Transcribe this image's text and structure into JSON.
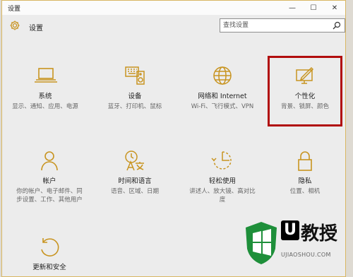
{
  "window": {
    "title": "设置",
    "controls": {
      "minimize": "—",
      "maximize": "☐",
      "close": "✕"
    }
  },
  "header": {
    "app_title": "设置",
    "search_placeholder": "查找设置"
  },
  "tiles": [
    {
      "icon": "laptop-icon",
      "label": "系统",
      "desc": "显示、通知、应用、电源"
    },
    {
      "icon": "keyboard-speaker-icon",
      "label": "设备",
      "desc": "蓝牙、打印机、鼠标"
    },
    {
      "icon": "globe-icon",
      "label": "网络和 Internet",
      "desc": "Wi-Fi、飞行模式、VPN"
    },
    {
      "icon": "paint-monitor-icon",
      "label": "个性化",
      "desc": "背景、锁屏、颜色"
    },
    {
      "icon": "person-icon",
      "label": "帐户",
      "desc": "你的帐户、电子邮件、同步设置、工作、其他用户"
    },
    {
      "icon": "language-icon",
      "label": "时间和语言",
      "desc": "语音、区域、日期"
    },
    {
      "icon": "ease-of-access-icon",
      "label": "轻松使用",
      "desc": "讲述人、放大镜、高对比度"
    },
    {
      "icon": "lock-icon",
      "label": "隐私",
      "desc": "位置、相机"
    },
    {
      "icon": "update-icon",
      "label": "更新和安全",
      "desc": ""
    }
  ],
  "watermark": {
    "brand": "教授",
    "letter": "U",
    "site": "UJIAOSHOU.COM"
  },
  "colors": {
    "accent": "#c89420",
    "highlight": "#b10d0d",
    "watermark_green": "#1e8f3a"
  }
}
